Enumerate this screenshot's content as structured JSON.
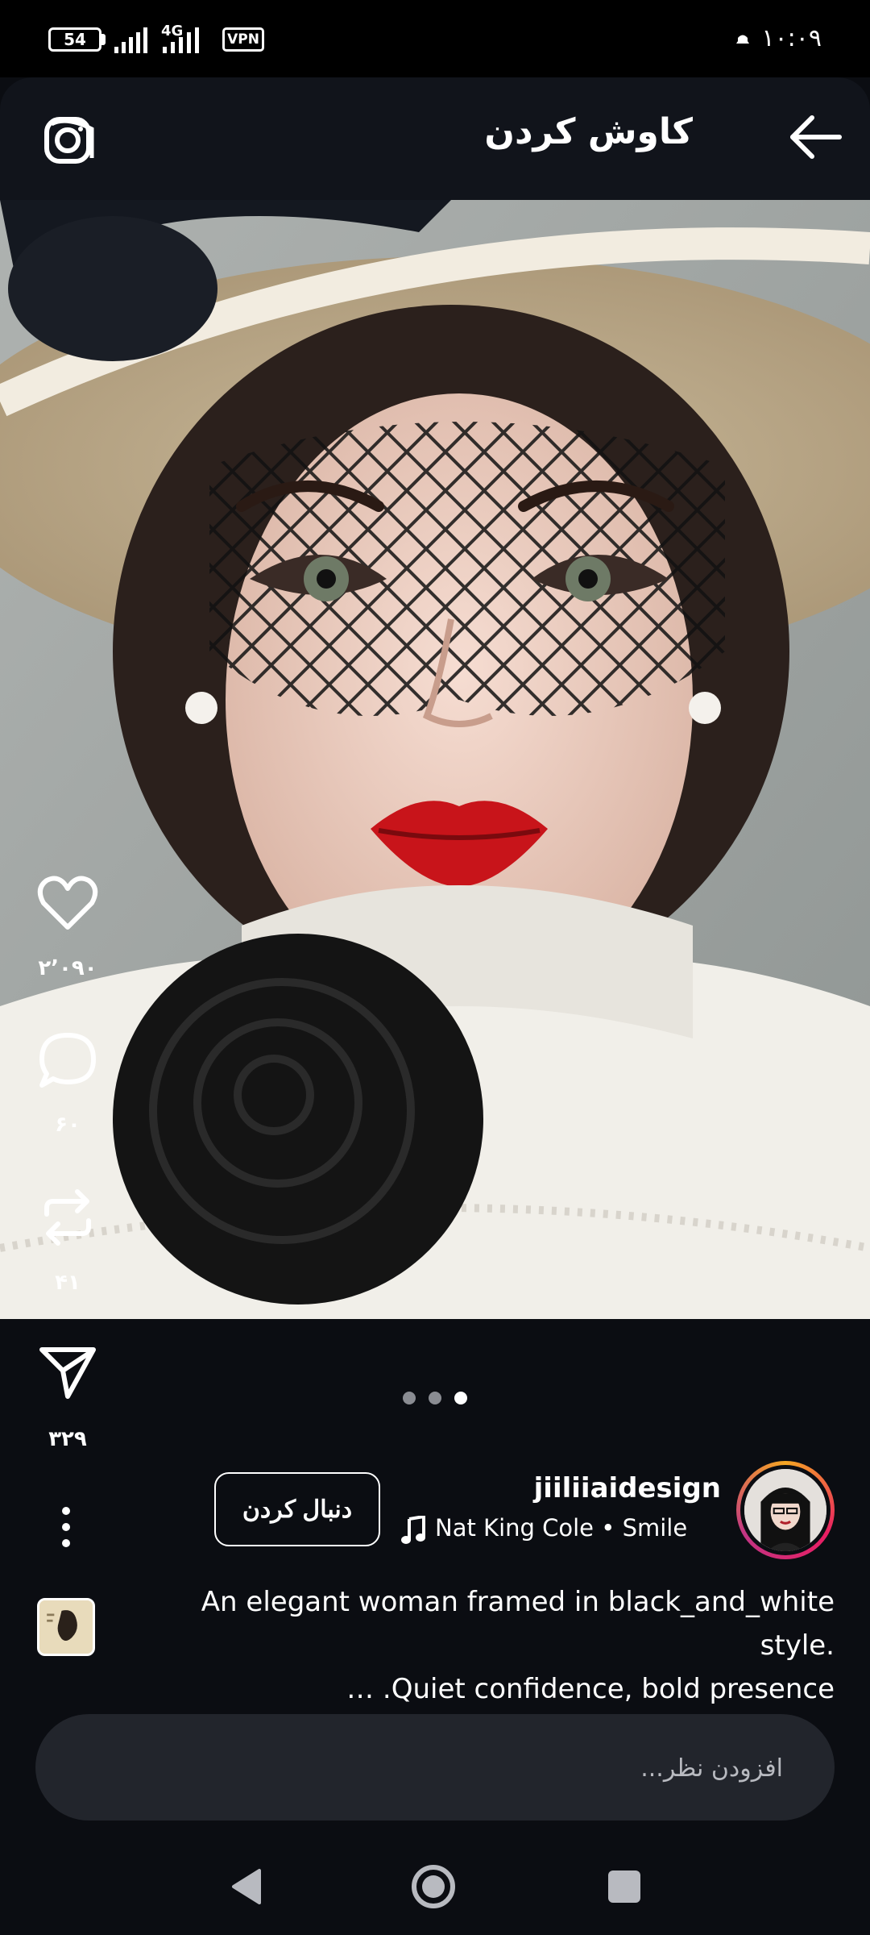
{
  "status_bar": {
    "battery": "54",
    "network": "4G",
    "vpn": "VPN",
    "time": "۱۰:۰۹"
  },
  "header": {
    "title": "کاوش کردن",
    "back_icon": "arrow-left-icon",
    "camera_icon": "camera-icon"
  },
  "actions": {
    "likes": "۲٬۰۹۰",
    "comments": "۶۰",
    "reposts": "۴۱",
    "shares": "۳۲۹"
  },
  "carousel": {
    "total": 3,
    "active": 3
  },
  "post": {
    "username": "jiiliiaidesign",
    "music": "Nat King Cole • Smile",
    "follow_label": "دنبال کردن",
    "caption_line1": "An elegant woman framed in black_and_white style.",
    "caption_line2": "… .Quiet confidence, bold presence"
  },
  "comment": {
    "placeholder": "افزودن نظر..."
  },
  "colors": {
    "background": "#0b0d12",
    "header": "#11141b",
    "input": "#22252c",
    "story_ring": "#e91e63",
    "lips": "#c8141a"
  }
}
